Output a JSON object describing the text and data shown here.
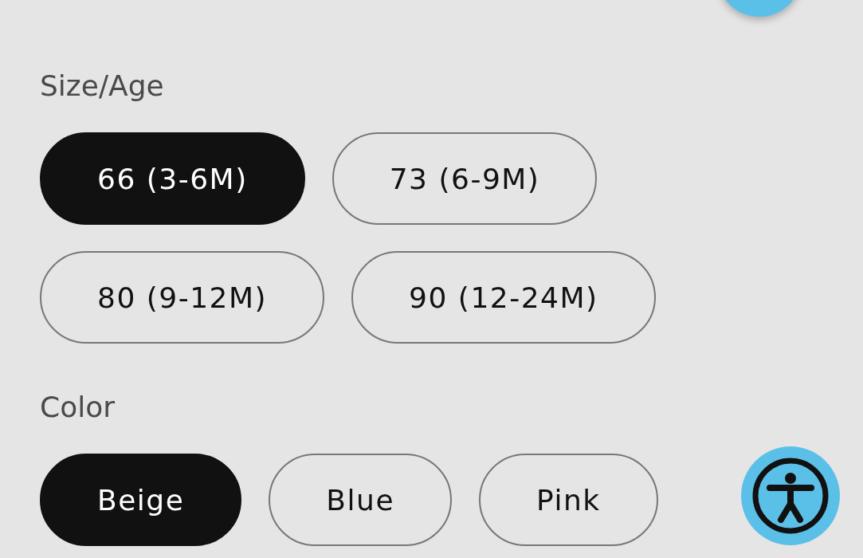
{
  "sections": [
    {
      "label": "Size/Age",
      "options": [
        {
          "label": "66 (3-6M)",
          "selected": true
        },
        {
          "label": "73 (6-9M)",
          "selected": false
        },
        {
          "label": "80 (9-12M)",
          "selected": false
        },
        {
          "label": "90 (12-24M)",
          "selected": false
        }
      ]
    },
    {
      "label": "Color",
      "options": [
        {
          "label": "Beige",
          "selected": true
        },
        {
          "label": "Blue",
          "selected": false
        },
        {
          "label": "Pink",
          "selected": false
        }
      ]
    }
  ]
}
